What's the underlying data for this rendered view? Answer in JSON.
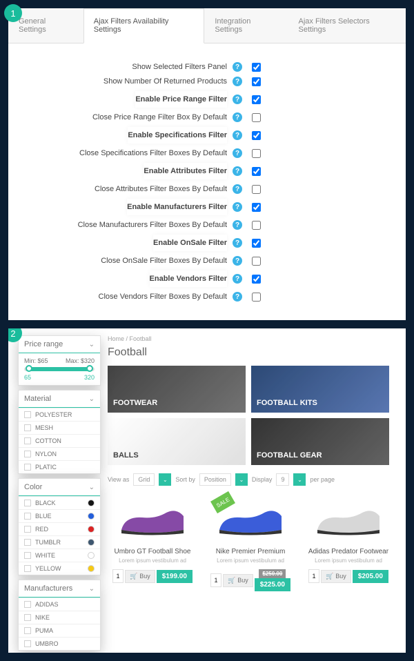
{
  "badge1": "1",
  "badge2": "2",
  "tabs": [
    "General Settings",
    "Ajax Filters Availability Settings",
    "Integration Settings",
    "Ajax Filters Selectors Settings"
  ],
  "settings": [
    {
      "label": "Show Selected Filters Panel",
      "hl": false,
      "checked": true
    },
    {
      "label": "Show Number Of Returned Products",
      "hl": false,
      "checked": true
    },
    {
      "label": "Enable Price Range Filter",
      "hl": true,
      "checked": true
    },
    {
      "label": "Close Price Range Filter Box By Default",
      "hl": false,
      "checked": false
    },
    {
      "label": "Enable Specifications Filter",
      "hl": true,
      "checked": true
    },
    {
      "label": "Close Specifications Filter Boxes By Default",
      "hl": false,
      "checked": false
    },
    {
      "label": "Enable Attributes Filter",
      "hl": true,
      "checked": true
    },
    {
      "label": "Close Attributes Filter Boxes By Default",
      "hl": false,
      "checked": false
    },
    {
      "label": "Enable Manufacturers Filter",
      "hl": true,
      "checked": true
    },
    {
      "label": "Close Manufacturers Filter Boxes By Default",
      "hl": false,
      "checked": false
    },
    {
      "label": "Enable OnSale Filter",
      "hl": true,
      "checked": true
    },
    {
      "label": "Close OnSale Filter Boxes By Default",
      "hl": false,
      "checked": false
    },
    {
      "label": "Enable Vendors Filter",
      "hl": true,
      "checked": true
    },
    {
      "label": "Close Vendors Filter Boxes By Default",
      "hl": false,
      "checked": false
    }
  ],
  "store": {
    "crumb": "Home / Football",
    "title": "Football",
    "price": {
      "head": "Price range",
      "minlabel": "Min: $65",
      "maxlabel": "Max: $320",
      "minval": "65",
      "maxval": "320"
    },
    "material": {
      "head": "Material",
      "opts": [
        "POLYESTER",
        "MESH",
        "COTTON",
        "NYLON",
        "PLATIC"
      ]
    },
    "color": {
      "head": "Color",
      "opts": [
        {
          "n": "BLACK",
          "c": "#000"
        },
        {
          "n": "BLUE",
          "c": "#1050d8"
        },
        {
          "n": "RED",
          "c": "#d81010"
        },
        {
          "n": "TUMBLR",
          "c": "#2c4762"
        },
        {
          "n": "WHITE",
          "c": "#fff"
        },
        {
          "n": "YELLOW",
          "c": "#f5c400"
        }
      ]
    },
    "manuf": {
      "head": "Manufacturers",
      "opts": [
        "ADIDAS",
        "NIKE",
        "PUMA",
        "UMBRO"
      ]
    },
    "cats": [
      "FOOTWEAR",
      "FOOTBALL KITS",
      "BALLS",
      "FOOTBALL GEAR"
    ],
    "toolbar": {
      "viewas": "View as",
      "grid": "Grid",
      "sortby": "Sort by",
      "position": "Position",
      "display": "Display",
      "nine": "9",
      "perpage": "per page"
    },
    "products": [
      {
        "name": "Umbro GT Football Shoe",
        "desc": "Lorem ipsum vestibulum ad",
        "price": "$199.00",
        "color": "#7b3a9e",
        "sale": false
      },
      {
        "name": "Nike Premier Premium",
        "desc": "Lorem ipsum vestibulum ad",
        "price": "$225.00",
        "old": "$250.00",
        "color": "#2a4fd6",
        "sale": true
      },
      {
        "name": "Adidas Predator Footwear",
        "desc": "Lorem ipsum vestibulum ad",
        "price": "$205.00",
        "color": "#d4d4d4",
        "sale": false
      }
    ],
    "saleLabel": "SALE",
    "buy": "Buy",
    "qty": "1"
  }
}
